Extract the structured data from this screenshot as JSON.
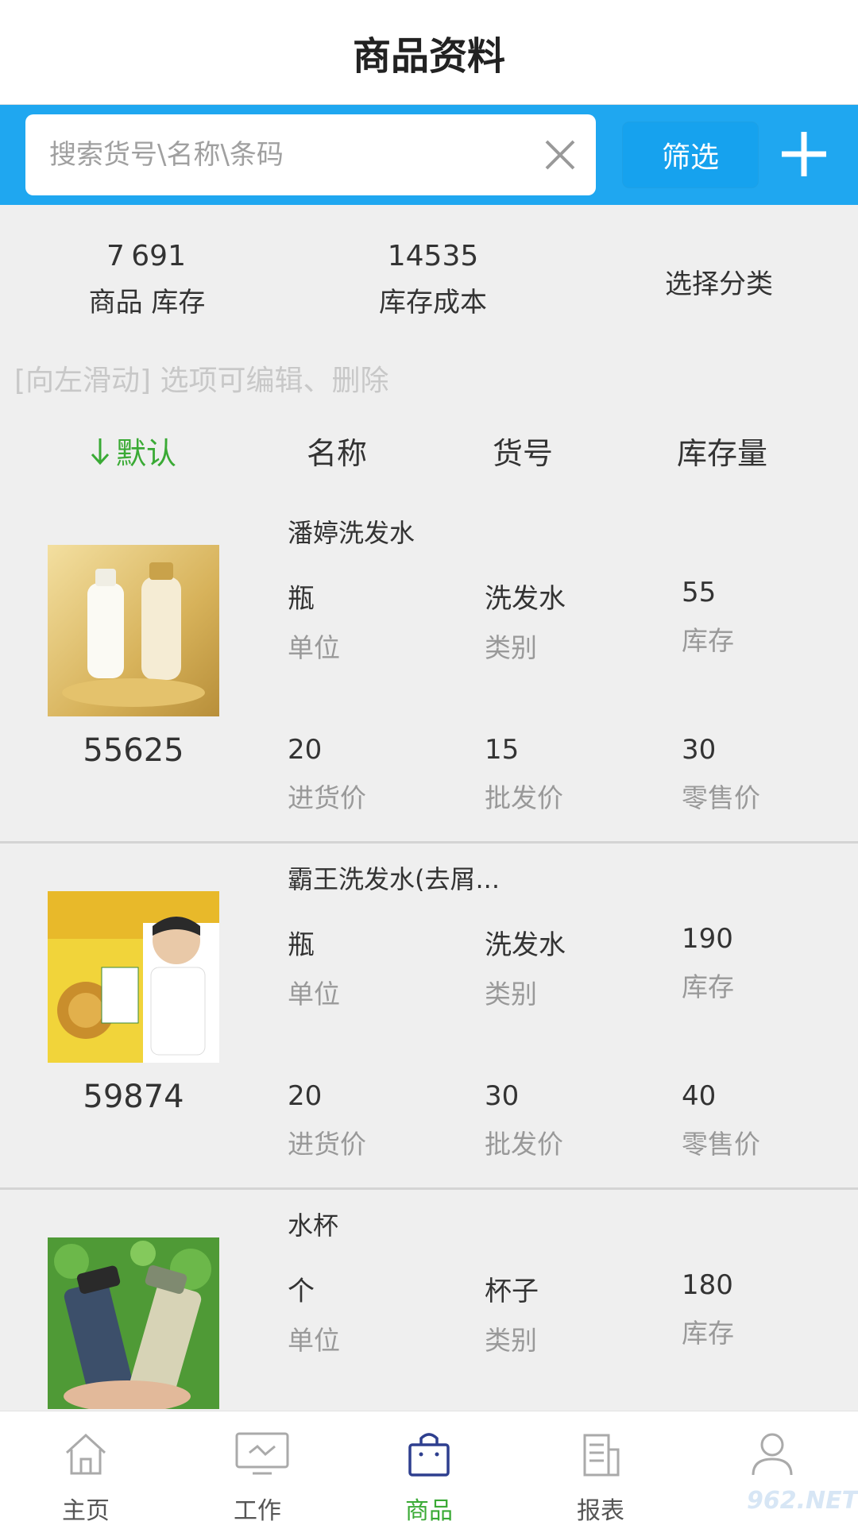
{
  "header": {
    "title": "商品资料"
  },
  "search": {
    "placeholder": "搜索货号\\名称\\条码",
    "filter_label": "筛选"
  },
  "stats": {
    "goods_count": "7",
    "stock_count": "691",
    "goods_stock_label": "商品 库存",
    "cost_value": "14535",
    "cost_label": "库存成本",
    "category_label": "选择分类"
  },
  "hint": "[向左滑动] 选项可编辑、删除",
  "sort": {
    "default": "默认",
    "name": "名称",
    "code": "货号",
    "stock": "库存量",
    "active_color": "#3aaa35"
  },
  "items": [
    {
      "name": "潘婷洗发水",
      "code": "55625",
      "unit": "瓶",
      "unit_label": "单位",
      "category": "洗发水",
      "category_label": "类别",
      "stock": "55",
      "stock_label": "库存",
      "purchase": "20",
      "purchase_label": "进货价",
      "wholesale": "15",
      "wholesale_label": "批发价",
      "retail": "30",
      "retail_label": "零售价"
    },
    {
      "name": "霸王洗发水(去屑...",
      "code": "59874",
      "unit": "瓶",
      "unit_label": "单位",
      "category": "洗发水",
      "category_label": "类别",
      "stock": "190",
      "stock_label": "库存",
      "purchase": "20",
      "purchase_label": "进货价",
      "wholesale": "30",
      "wholesale_label": "批发价",
      "retail": "40",
      "retail_label": "零售价"
    },
    {
      "name": "水杯",
      "code": "",
      "unit": "个",
      "unit_label": "单位",
      "category": "杯子",
      "category_label": "类别",
      "stock": "180",
      "stock_label": "库存",
      "purchase": "",
      "purchase_label": "",
      "wholesale": "",
      "wholesale_label": "",
      "retail": "",
      "retail_label": ""
    }
  ],
  "tabs": [
    {
      "label": "主页",
      "icon": "home-icon"
    },
    {
      "label": "工作",
      "icon": "monitor-icon"
    },
    {
      "label": "商品",
      "icon": "shopping-bag-icon"
    },
    {
      "label": "报表",
      "icon": "report-icon"
    },
    {
      "label": "",
      "icon": "user-icon"
    }
  ],
  "watermark": "962.NET",
  "colors": {
    "brand_blue": "#1fa7f0",
    "active_green": "#3aaa35"
  }
}
